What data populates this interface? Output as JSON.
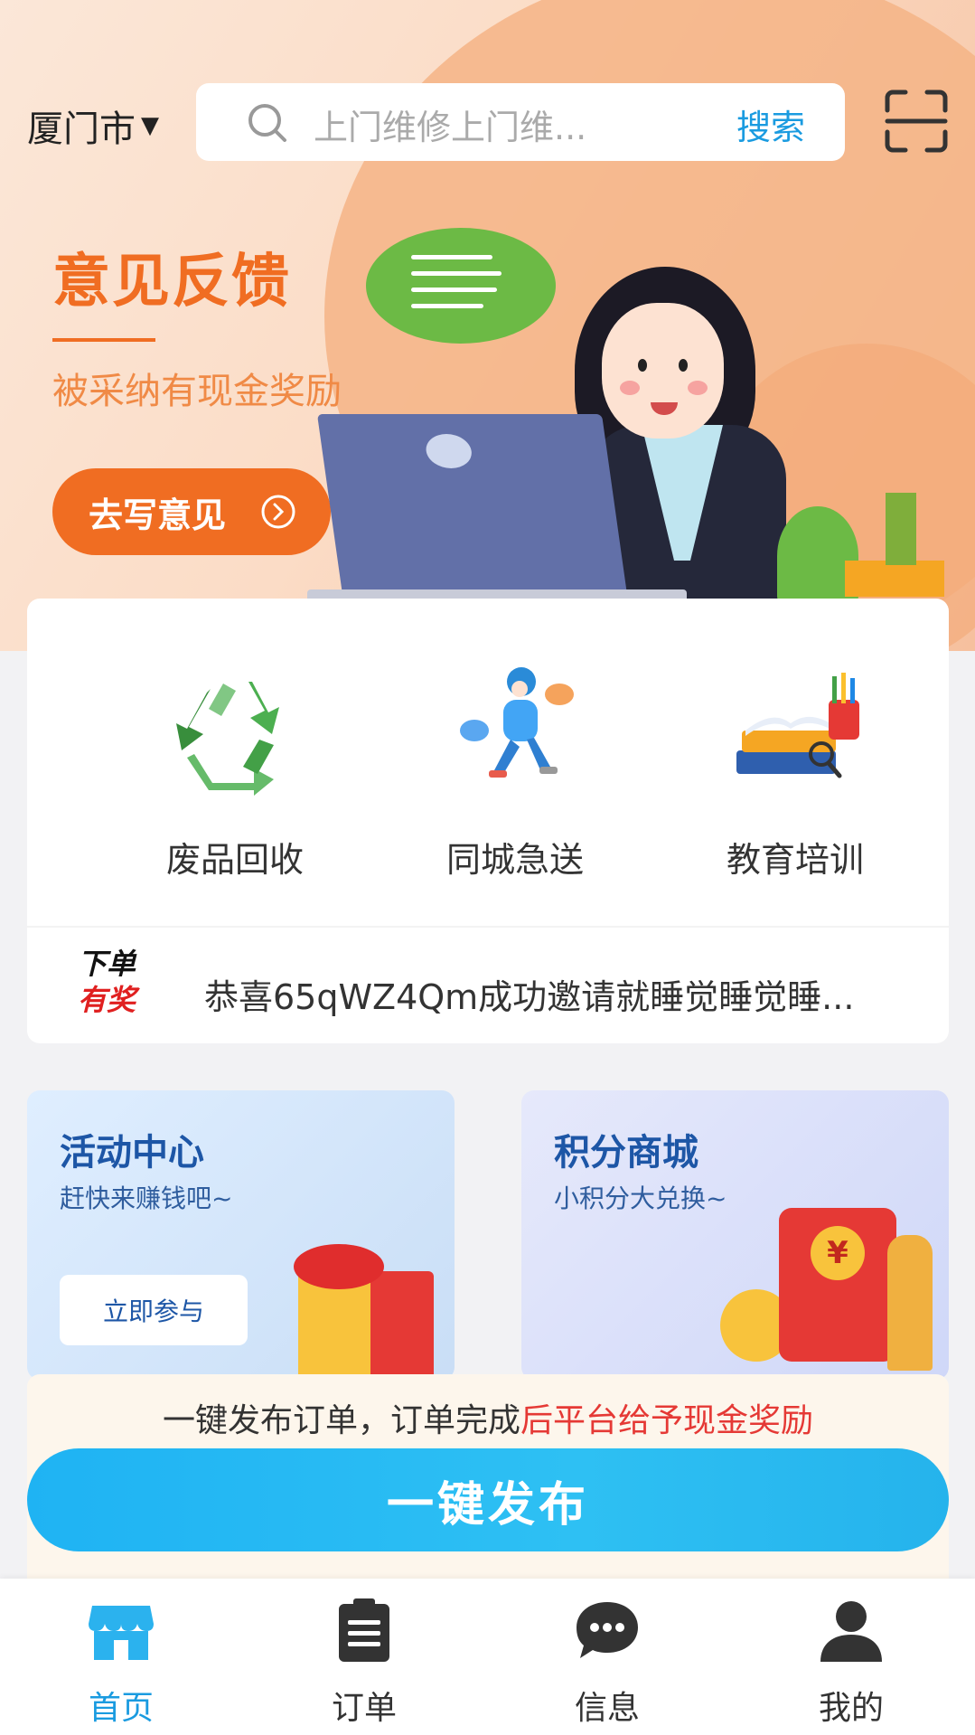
{
  "header": {
    "city": "厦门市",
    "search_placeholder": "上门维修上门维...",
    "search_button": "搜索"
  },
  "banner": {
    "title": "意见反馈",
    "subtitle": "被采纳有现金奖励",
    "button": "去写意见"
  },
  "services": [
    {
      "label": "废品回收",
      "icon": "recycle-icon"
    },
    {
      "label": "同城急送",
      "icon": "courier-icon"
    },
    {
      "label": "教育培训",
      "icon": "books-icon"
    }
  ],
  "ticker": {
    "tag_line1": "下单",
    "tag_line2": "有奖",
    "text": "恭喜65qWZ4Qm成功邀请就睡觉睡觉睡..."
  },
  "promos": {
    "activity": {
      "title": "活动中心",
      "subtitle": "赶快来赚钱吧~",
      "button": "立即参与"
    },
    "mall": {
      "title": "积分商城",
      "subtitle": "小积分大兑换~"
    }
  },
  "publish": {
    "note_prefix": "一键发布订单，订单完成",
    "note_highlight": "后平台给予现金奖励",
    "button": "一键发布"
  },
  "nav": {
    "items": [
      {
        "label": "首页",
        "icon": "home-shop-icon",
        "active": true
      },
      {
        "label": "订单",
        "icon": "clipboard-icon",
        "active": false
      },
      {
        "label": "信息",
        "icon": "chat-bubble-icon",
        "active": false
      },
      {
        "label": "我的",
        "icon": "user-icon",
        "active": false
      }
    ]
  },
  "colors": {
    "accent_blue": "#1a9be0",
    "banner_orange": "#f06d22",
    "highlight_red": "#e53935"
  }
}
